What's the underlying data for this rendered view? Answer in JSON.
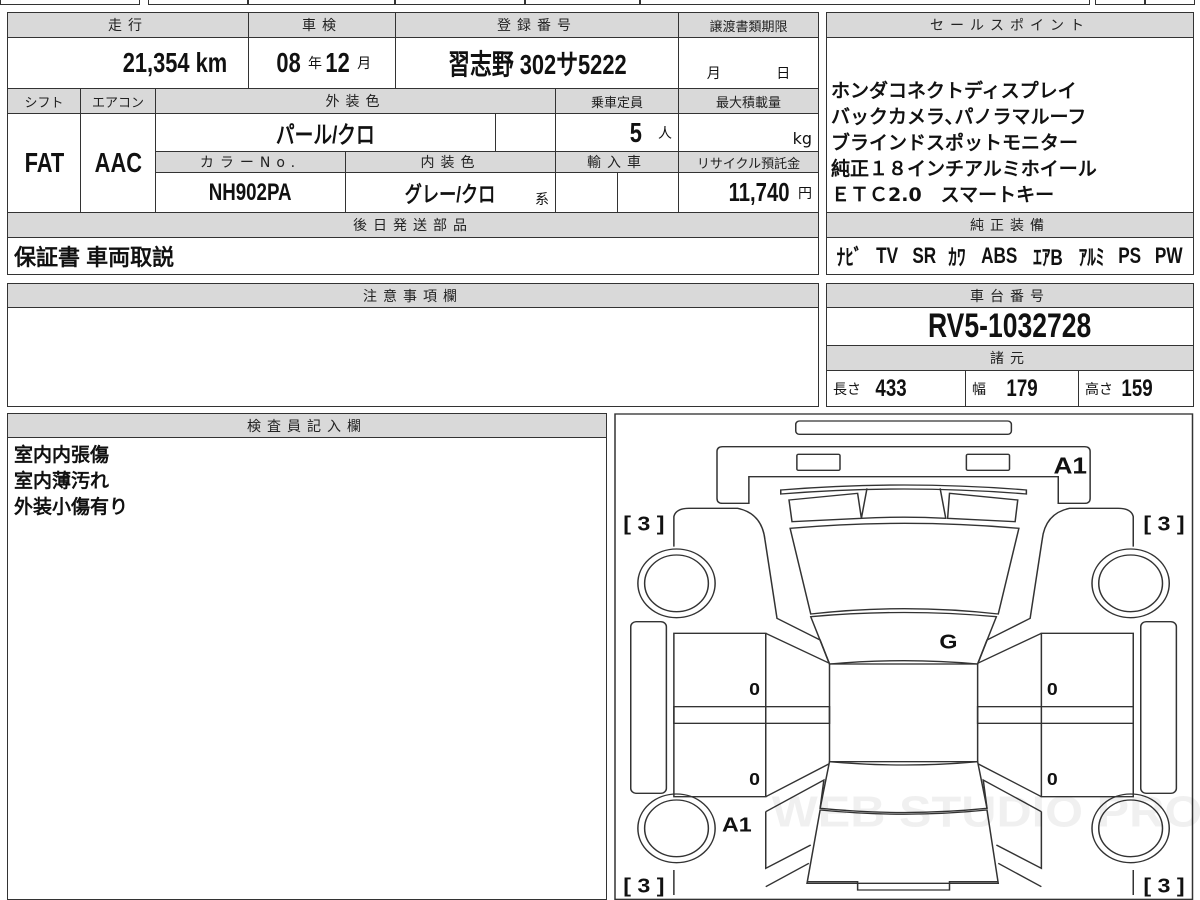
{
  "summary": {
    "mileage_label": "走行",
    "mileage_value": "21,354",
    "mileage_unit": "km",
    "inspection_label": "車検",
    "inspection_year": "08",
    "year_unit": "年",
    "inspection_month": "12",
    "month_unit": "月",
    "registration_label": "登録番号",
    "registration_value": "習志野 302サ5222",
    "transfer_label": "譲渡書類期限",
    "transfer_month_unit": "月",
    "transfer_day_unit": "日",
    "shift_label": "シフト",
    "shift_value": "FAT",
    "aircon_label": "エアコン",
    "aircon_value": "AAC",
    "exterior_color_label": "外装色",
    "exterior_color_value": "パール/クロ",
    "capacity_label": "乗車定員",
    "capacity_value": "5",
    "capacity_unit": "人",
    "max_load_label": "最大積載量",
    "max_load_unit": "kg",
    "color_no_label": "カラーNo.",
    "color_no_value": "NH902PA",
    "interior_color_label": "内装色",
    "interior_color_value": "グレー/クロ",
    "interior_suffix": "系",
    "import_label": "輸入車",
    "recycle_label": "リサイクル預託金",
    "recycle_value": "11,740",
    "recycle_unit": "円",
    "parts_label": "後日発送部品",
    "parts_value": "保証書 車両取説"
  },
  "sales_points": {
    "label": "セールスポイント",
    "lines": [
      "ホンダコネクトディスプレイ",
      "バックカメラ､パノラマルーフ",
      "ブラインドスポットモニター",
      "純正１８インチアルミホイール",
      "ＥＴＣ2.0　スマートキー"
    ]
  },
  "equipment": {
    "label": "純正装備",
    "items": [
      "ﾅﾋﾞ",
      "TV",
      "SR",
      "ｶﾜ",
      "ABS",
      "ｴｱB",
      "ｱﾙﾐ",
      "PS",
      "PW"
    ]
  },
  "notes": {
    "label": "注意事項欄"
  },
  "chassis": {
    "label": "車台番号",
    "value": "RV5-1032728"
  },
  "specs": {
    "label": "諸元",
    "length_label": "長さ",
    "length": "433",
    "width_label": "幅",
    "width": "179",
    "height_label": "高さ",
    "height": "159"
  },
  "inspector": {
    "label": "検査員記入欄",
    "lines": [
      "室内内張傷",
      "室内薄汚れ",
      "外装小傷有り"
    ]
  },
  "diagram": {
    "marks": {
      "front_right": "A1",
      "roof": "G",
      "rear_left": "A1",
      "door_fl": "0",
      "door_rl": "0",
      "door_fr": "0",
      "door_rr": "0"
    },
    "tires": {
      "fl": "[ 3 ]",
      "fr": "[ 3 ]",
      "rl": "[ 3 ]",
      "rr": "[ 3 ]"
    },
    "watermark": "WEB STUDIO PRO"
  }
}
